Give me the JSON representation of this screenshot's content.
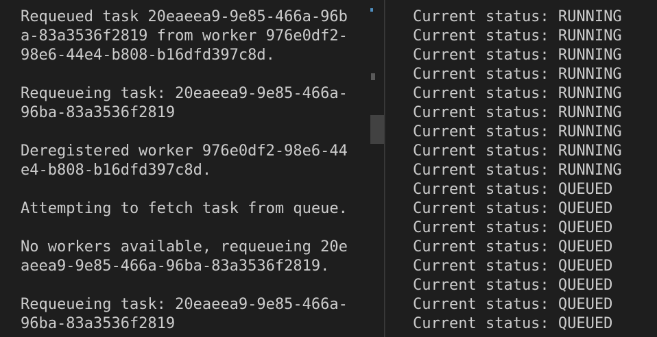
{
  "left_terminal": {
    "lines": [
      "Requeued task 20eaeea9-9e85-466a-96b",
      "a-83a3536f2819 from worker 976e0df2-",
      "98e6-44e4-b808-b16dfd397c8d.",
      "",
      "Requeueing task: 20eaeea9-9e85-466a-",
      "96ba-83a3536f2819",
      "",
      "Deregistered worker 976e0df2-98e6-44",
      "e4-b808-b16dfd397c8d.",
      "",
      "Attempting to fetch task from queue.",
      "",
      "No workers available, requeueing 20e",
      "aeea9-9e85-466a-96ba-83a3536f2819.",
      "",
      "Requeueing task: 20eaeea9-9e85-466a-",
      "96ba-83a3536f2819"
    ]
  },
  "right_terminal": {
    "lines": [
      "Current status: RUNNING",
      "Current status: RUNNING",
      "Current status: RUNNING",
      "Current status: RUNNING",
      "Current status: RUNNING",
      "Current status: RUNNING",
      "Current status: RUNNING",
      "Current status: RUNNING",
      "Current status: RUNNING",
      "Current status: QUEUED",
      "Current status: QUEUED",
      "Current status: QUEUED",
      "Current status: QUEUED",
      "Current status: QUEUED",
      "Current status: QUEUED",
      "Current status: QUEUED",
      "Current status: QUEUED"
    ]
  },
  "colors": {
    "background": "#1e1e1e",
    "text": "#cccccc",
    "scroll_thumb": "#424242",
    "divider": "#3a3a3a",
    "cursor_mark": "#4f8fc0"
  }
}
